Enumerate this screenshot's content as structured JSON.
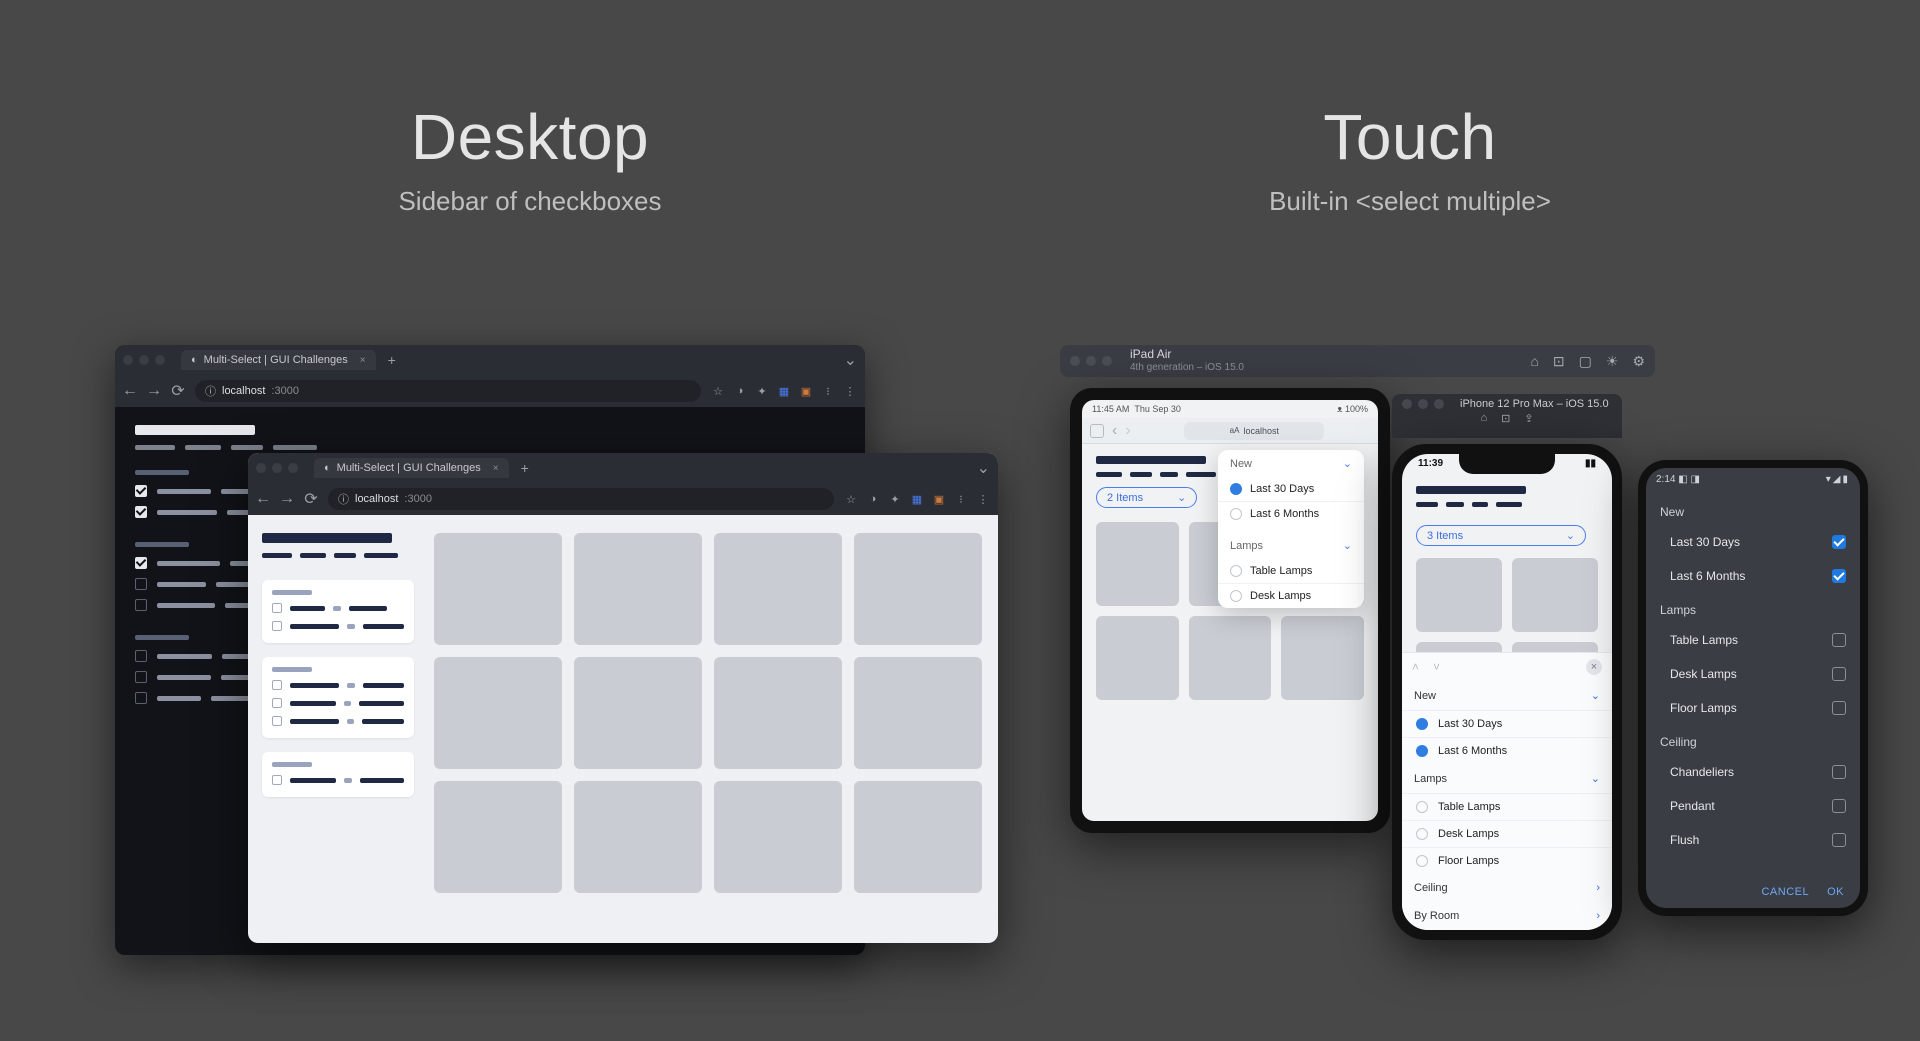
{
  "left": {
    "title": "Desktop",
    "subtitle": "Sidebar of checkboxes"
  },
  "right": {
    "title": "Touch",
    "subtitle": "Built-in <select multiple>"
  },
  "browser_dark": {
    "tab": "Multi-Select | GUI Challenges",
    "url_host": "localhost",
    "url_port": ":3000",
    "groups": [
      {
        "items": [
          {
            "checked": true
          },
          {
            "checked": true
          }
        ]
      },
      {
        "items": [
          {
            "checked": true
          },
          {
            "checked": false
          },
          {
            "checked": false
          }
        ]
      },
      {
        "items": [
          {
            "checked": false
          },
          {
            "checked": false
          },
          {
            "checked": false
          }
        ]
      }
    ]
  },
  "browser_light": {
    "tab": "Multi-Select | GUI Challenges",
    "url_host": "localhost",
    "url_port": ":3000",
    "groups": [
      {
        "items": 2
      },
      {
        "items": 3
      },
      {
        "items": 1
      }
    ]
  },
  "simulator": {
    "device": "iPad Air",
    "detail": "4th generation – iOS 15.0"
  },
  "ipad": {
    "status_time": "11:45 AM",
    "status_date": "Thu Sep 30",
    "url": "localhost",
    "url_prefix": "aA",
    "pill": "2 Items",
    "popover": {
      "sections": [
        {
          "name": "New",
          "options": [
            {
              "label": "Last 30 Days",
              "selected": true
            },
            {
              "label": "Last 6 Months",
              "selected": false
            }
          ]
        },
        {
          "name": "Lamps",
          "options": [
            {
              "label": "Table Lamps",
              "selected": false
            },
            {
              "label": "Desk Lamps",
              "selected": false
            }
          ]
        }
      ]
    }
  },
  "iphone_bar": {
    "title": "iPhone 12 Pro Max – iOS 15.0"
  },
  "iphone": {
    "time": "11:39",
    "pill": "3 Items",
    "sheet": {
      "sections": [
        {
          "name": "New",
          "expanded": true,
          "options": [
            {
              "label": "Last 30 Days",
              "selected": true
            },
            {
              "label": "Last 6 Months",
              "selected": true
            }
          ]
        },
        {
          "name": "Lamps",
          "expanded": true,
          "options": [
            {
              "label": "Table Lamps",
              "selected": false
            },
            {
              "label": "Desk Lamps",
              "selected": false
            },
            {
              "label": "Floor Lamps",
              "selected": false
            }
          ]
        },
        {
          "name": "Ceiling",
          "expanded": false,
          "options": []
        },
        {
          "name": "By Room",
          "expanded": false,
          "options": []
        }
      ]
    }
  },
  "android": {
    "time": "2:14",
    "groups": [
      {
        "name": "New",
        "options": [
          {
            "label": "Last 30 Days",
            "checked": true
          },
          {
            "label": "Last 6 Months",
            "checked": true
          }
        ]
      },
      {
        "name": "Lamps",
        "options": [
          {
            "label": "Table Lamps",
            "checked": false
          },
          {
            "label": "Desk Lamps",
            "checked": false
          },
          {
            "label": "Floor Lamps",
            "checked": false
          }
        ]
      },
      {
        "name": "Ceiling",
        "options": [
          {
            "label": "Chandeliers",
            "checked": false
          },
          {
            "label": "Pendant",
            "checked": false
          },
          {
            "label": "Flush",
            "checked": false
          }
        ]
      }
    ],
    "cancel": "CANCEL",
    "ok": "OK"
  }
}
